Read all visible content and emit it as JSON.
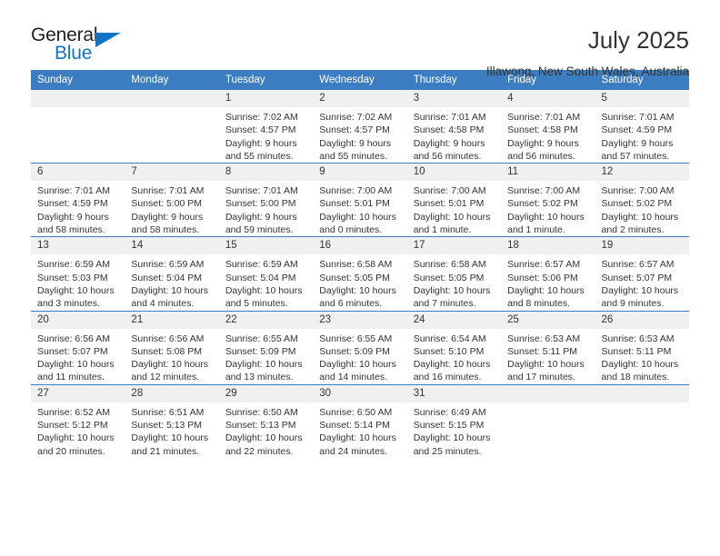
{
  "logo": {
    "word_top": "General",
    "word_bottom": "Blue"
  },
  "header": {
    "title": "July 2025",
    "subtitle": "Illawong, New South Wales, Australia"
  },
  "calendar": {
    "weekday_headers": [
      "Sunday",
      "Monday",
      "Tuesday",
      "Wednesday",
      "Thursday",
      "Friday",
      "Saturday"
    ],
    "header_bg": "#3b7dc0",
    "daynum_bg": "#f0f0f0",
    "weeks": [
      [
        {
          "day": "",
          "lines": []
        },
        {
          "day": "",
          "lines": []
        },
        {
          "day": "1",
          "lines": [
            "Sunrise: 7:02 AM",
            "Sunset: 4:57 PM",
            "Daylight: 9 hours",
            "and 55 minutes."
          ]
        },
        {
          "day": "2",
          "lines": [
            "Sunrise: 7:02 AM",
            "Sunset: 4:57 PM",
            "Daylight: 9 hours",
            "and 55 minutes."
          ]
        },
        {
          "day": "3",
          "lines": [
            "Sunrise: 7:01 AM",
            "Sunset: 4:58 PM",
            "Daylight: 9 hours",
            "and 56 minutes."
          ]
        },
        {
          "day": "4",
          "lines": [
            "Sunrise: 7:01 AM",
            "Sunset: 4:58 PM",
            "Daylight: 9 hours",
            "and 56 minutes."
          ]
        },
        {
          "day": "5",
          "lines": [
            "Sunrise: 7:01 AM",
            "Sunset: 4:59 PM",
            "Daylight: 9 hours",
            "and 57 minutes."
          ]
        }
      ],
      [
        {
          "day": "6",
          "lines": [
            "Sunrise: 7:01 AM",
            "Sunset: 4:59 PM",
            "Daylight: 9 hours",
            "and 58 minutes."
          ]
        },
        {
          "day": "7",
          "lines": [
            "Sunrise: 7:01 AM",
            "Sunset: 5:00 PM",
            "Daylight: 9 hours",
            "and 58 minutes."
          ]
        },
        {
          "day": "8",
          "lines": [
            "Sunrise: 7:01 AM",
            "Sunset: 5:00 PM",
            "Daylight: 9 hours",
            "and 59 minutes."
          ]
        },
        {
          "day": "9",
          "lines": [
            "Sunrise: 7:00 AM",
            "Sunset: 5:01 PM",
            "Daylight: 10 hours",
            "and 0 minutes."
          ]
        },
        {
          "day": "10",
          "lines": [
            "Sunrise: 7:00 AM",
            "Sunset: 5:01 PM",
            "Daylight: 10 hours",
            "and 1 minute."
          ]
        },
        {
          "day": "11",
          "lines": [
            "Sunrise: 7:00 AM",
            "Sunset: 5:02 PM",
            "Daylight: 10 hours",
            "and 1 minute."
          ]
        },
        {
          "day": "12",
          "lines": [
            "Sunrise: 7:00 AM",
            "Sunset: 5:02 PM",
            "Daylight: 10 hours",
            "and 2 minutes."
          ]
        }
      ],
      [
        {
          "day": "13",
          "lines": [
            "Sunrise: 6:59 AM",
            "Sunset: 5:03 PM",
            "Daylight: 10 hours",
            "and 3 minutes."
          ]
        },
        {
          "day": "14",
          "lines": [
            "Sunrise: 6:59 AM",
            "Sunset: 5:04 PM",
            "Daylight: 10 hours",
            "and 4 minutes."
          ]
        },
        {
          "day": "15",
          "lines": [
            "Sunrise: 6:59 AM",
            "Sunset: 5:04 PM",
            "Daylight: 10 hours",
            "and 5 minutes."
          ]
        },
        {
          "day": "16",
          "lines": [
            "Sunrise: 6:58 AM",
            "Sunset: 5:05 PM",
            "Daylight: 10 hours",
            "and 6 minutes."
          ]
        },
        {
          "day": "17",
          "lines": [
            "Sunrise: 6:58 AM",
            "Sunset: 5:05 PM",
            "Daylight: 10 hours",
            "and 7 minutes."
          ]
        },
        {
          "day": "18",
          "lines": [
            "Sunrise: 6:57 AM",
            "Sunset: 5:06 PM",
            "Daylight: 10 hours",
            "and 8 minutes."
          ]
        },
        {
          "day": "19",
          "lines": [
            "Sunrise: 6:57 AM",
            "Sunset: 5:07 PM",
            "Daylight: 10 hours",
            "and 9 minutes."
          ]
        }
      ],
      [
        {
          "day": "20",
          "lines": [
            "Sunrise: 6:56 AM",
            "Sunset: 5:07 PM",
            "Daylight: 10 hours",
            "and 11 minutes."
          ]
        },
        {
          "day": "21",
          "lines": [
            "Sunrise: 6:56 AM",
            "Sunset: 5:08 PM",
            "Daylight: 10 hours",
            "and 12 minutes."
          ]
        },
        {
          "day": "22",
          "lines": [
            "Sunrise: 6:55 AM",
            "Sunset: 5:09 PM",
            "Daylight: 10 hours",
            "and 13 minutes."
          ]
        },
        {
          "day": "23",
          "lines": [
            "Sunrise: 6:55 AM",
            "Sunset: 5:09 PM",
            "Daylight: 10 hours",
            "and 14 minutes."
          ]
        },
        {
          "day": "24",
          "lines": [
            "Sunrise: 6:54 AM",
            "Sunset: 5:10 PM",
            "Daylight: 10 hours",
            "and 16 minutes."
          ]
        },
        {
          "day": "25",
          "lines": [
            "Sunrise: 6:53 AM",
            "Sunset: 5:11 PM",
            "Daylight: 10 hours",
            "and 17 minutes."
          ]
        },
        {
          "day": "26",
          "lines": [
            "Sunrise: 6:53 AM",
            "Sunset: 5:11 PM",
            "Daylight: 10 hours",
            "and 18 minutes."
          ]
        }
      ],
      [
        {
          "day": "27",
          "lines": [
            "Sunrise: 6:52 AM",
            "Sunset: 5:12 PM",
            "Daylight: 10 hours",
            "and 20 minutes."
          ]
        },
        {
          "day": "28",
          "lines": [
            "Sunrise: 6:51 AM",
            "Sunset: 5:13 PM",
            "Daylight: 10 hours",
            "and 21 minutes."
          ]
        },
        {
          "day": "29",
          "lines": [
            "Sunrise: 6:50 AM",
            "Sunset: 5:13 PM",
            "Daylight: 10 hours",
            "and 22 minutes."
          ]
        },
        {
          "day": "30",
          "lines": [
            "Sunrise: 6:50 AM",
            "Sunset: 5:14 PM",
            "Daylight: 10 hours",
            "and 24 minutes."
          ]
        },
        {
          "day": "31",
          "lines": [
            "Sunrise: 6:49 AM",
            "Sunset: 5:15 PM",
            "Daylight: 10 hours",
            "and 25 minutes."
          ]
        },
        {
          "day": "",
          "lines": []
        },
        {
          "day": "",
          "lines": []
        }
      ]
    ]
  }
}
